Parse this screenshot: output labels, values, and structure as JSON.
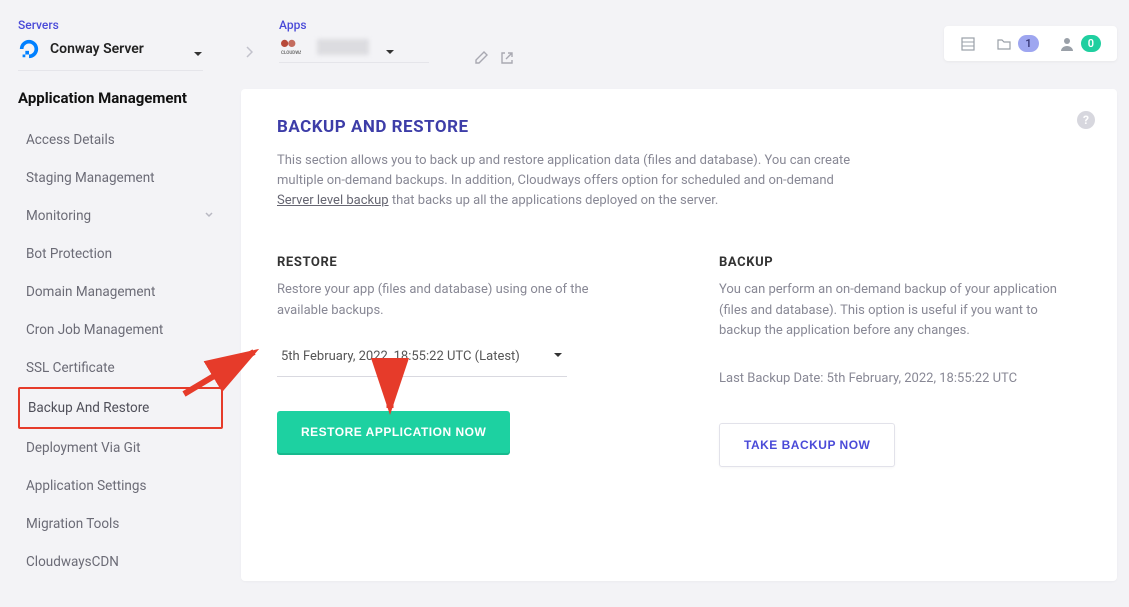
{
  "header": {
    "servers_label": "Servers",
    "server_name": "Conway Server",
    "apps_label": "Apps",
    "folder_badge": "1",
    "user_badge": "0"
  },
  "sidebar": {
    "title": "Application Management",
    "items": [
      {
        "label": "Access Details"
      },
      {
        "label": "Staging Management"
      },
      {
        "label": "Monitoring",
        "children": true
      },
      {
        "label": "Bot Protection"
      },
      {
        "label": "Domain Management"
      },
      {
        "label": "Cron Job Management"
      },
      {
        "label": "SSL Certificate"
      },
      {
        "label": "Backup And Restore",
        "active": true
      },
      {
        "label": "Deployment Via Git"
      },
      {
        "label": "Application Settings"
      },
      {
        "label": "Migration Tools"
      },
      {
        "label": "CloudwaysCDN"
      }
    ]
  },
  "panel": {
    "title": "BACKUP AND RESTORE",
    "desc_1": "This section allows you to back up and restore application data (files and database). You can create multiple on-demand backups. In addition, Cloudways offers option for scheduled and on-demand ",
    "desc_link": "Server level backup",
    "desc_2": " that backs up all the applications deployed on the server."
  },
  "restore": {
    "heading": "RESTORE",
    "text": "Restore your app (files and database) using one of the available backups.",
    "selected": "5th February, 2022, 18:55:22 UTC (Latest)",
    "button": "RESTORE APPLICATION NOW"
  },
  "backup": {
    "heading": "BACKUP",
    "text": "You can perform an on-demand backup of your application (files and database). This option is useful if you want to backup the application before any changes.",
    "last_label": "Last Backup Date: 5th February, 2022, 18:55:22 UTC",
    "button": "TAKE BACKUP NOW"
  }
}
